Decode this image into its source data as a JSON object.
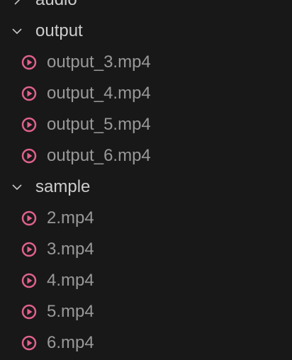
{
  "explorer": {
    "folders": [
      {
        "name": "audio",
        "expanded": false,
        "files": []
      },
      {
        "name": "output",
        "expanded": true,
        "files": [
          "output_3.mp4",
          "output_4.mp4",
          "output_5.mp4",
          "output_6.mp4"
        ]
      },
      {
        "name": "sample",
        "expanded": true,
        "files": [
          "2.mp4",
          "3.mp4",
          "4.mp4",
          "5.mp4",
          "6.mp4"
        ]
      }
    ]
  },
  "icons": {
    "folder_collapsed": "chevron-right-icon",
    "folder_expanded": "chevron-down-icon",
    "video_file": "video-file-icon"
  },
  "colors": {
    "background": "#181818",
    "folder_text": "#cccccc",
    "file_text": "#999999",
    "chevron": "#c5c5c5",
    "video_icon": "#e0628b"
  }
}
